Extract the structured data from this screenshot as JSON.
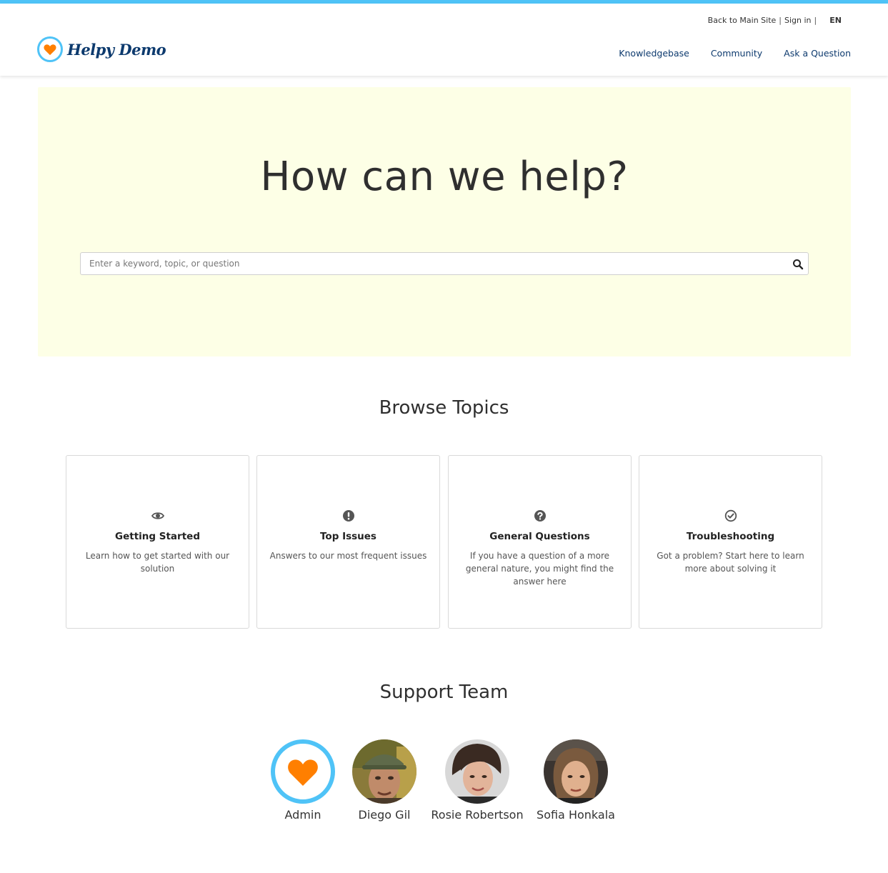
{
  "header": {
    "brand": "Helpy Demo",
    "back_link": "Back to Main Site",
    "separator": "|",
    "sign_in": "Sign in",
    "language": "EN",
    "nav": [
      "Knowledgebase",
      "Community",
      "Ask a Question"
    ]
  },
  "hero": {
    "title": "How can we help?",
    "search_placeholder": "Enter a keyword, topic, or question"
  },
  "browse": {
    "title": "Browse Topics",
    "topics": [
      {
        "icon": "eye-icon",
        "title": "Getting Started",
        "description": "Learn how to get started with our solution"
      },
      {
        "icon": "exclamation-circle-icon",
        "title": "Top Issues",
        "description": "Answers to our most frequent issues"
      },
      {
        "icon": "question-circle-icon",
        "title": "General Questions",
        "description": "If you have a question of a more general nature, you might find the answer here"
      },
      {
        "icon": "check-circle-icon",
        "title": "Troubleshooting",
        "description": "Got a problem? Start here to learn more about solving it"
      }
    ]
  },
  "team": {
    "title": "Support Team",
    "members": [
      {
        "name": "Admin"
      },
      {
        "name": "Diego Gil"
      },
      {
        "name": "Rosie Robertson"
      },
      {
        "name": "Sofia Honkala"
      }
    ]
  },
  "colors": {
    "accent": "#4fc3f7",
    "brand": "#0d3a6e",
    "heart": "#ff7f00",
    "hero_bg": "#fdffe6"
  }
}
